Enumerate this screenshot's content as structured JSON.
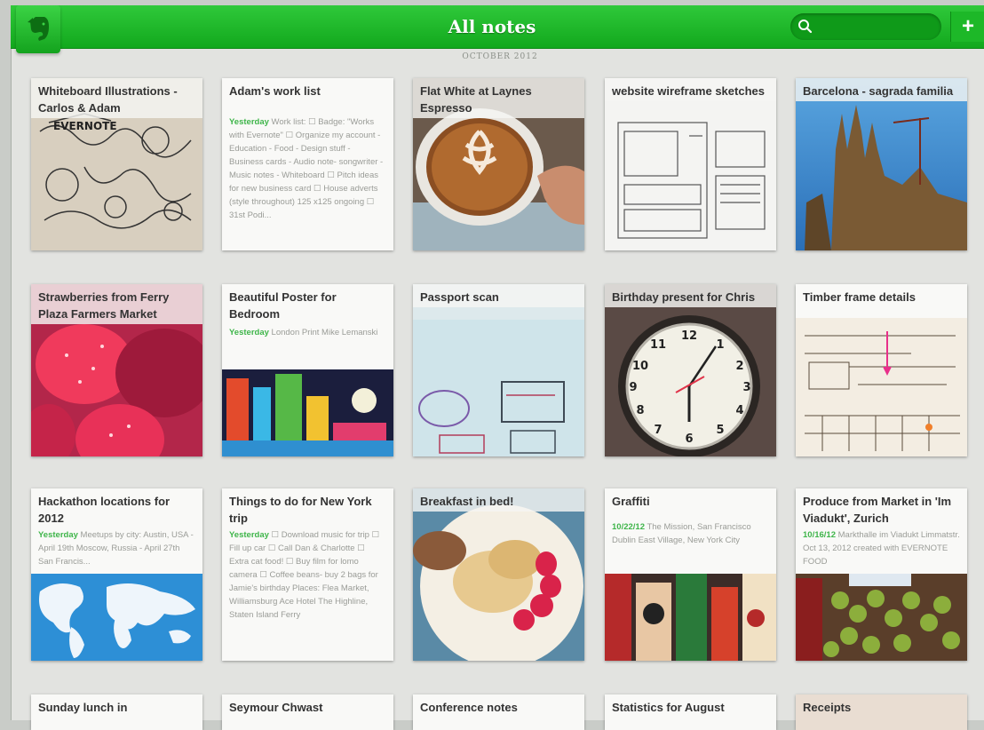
{
  "app": {
    "title": "All notes",
    "month": "OCTOBER 2012",
    "accent": "#22b82d"
  },
  "search": {
    "placeholder": "",
    "value": ""
  },
  "toolbar": {
    "new_note": "+"
  },
  "notes": [
    {
      "title": "Whiteboard Illustrations - Carlos & Adam",
      "date": "",
      "snippet": ""
    },
    {
      "title": "Adam's work list",
      "date": "Yesterday",
      "snippet": "Work list: ☐ Badge: \"Works with Evernote\" ☐ Organize my account - Education - Food - Design stuff - Business cards - Audio note- songwriter - Music notes - Whiteboard ☐ Pitch ideas for new business card ☐ House adverts (style throughout) 125 x125 ongoing ☐ 31st Podi..."
    },
    {
      "title": "Flat White at Laynes Espresso",
      "date": "",
      "snippet": ""
    },
    {
      "title": "website wireframe sketches",
      "date": "",
      "snippet": ""
    },
    {
      "title": "Barcelona - sagrada familia",
      "date": "",
      "snippet": ""
    },
    {
      "title": "Strawberries from Ferry Plaza Farmers Market",
      "date": "",
      "snippet": ""
    },
    {
      "title": "Beautiful  Poster for Bedroom",
      "date": "Yesterday",
      "snippet": "London Print Mike Lemanski"
    },
    {
      "title": "Passport scan",
      "date": "",
      "snippet": ""
    },
    {
      "title": "Birthday present for Chris",
      "date": "",
      "snippet": ""
    },
    {
      "title": "Timber frame details",
      "date": "",
      "snippet": ""
    },
    {
      "title": "Hackathon locations for 2012",
      "date": "Yesterday",
      "snippet": "Meetups by city: Austin, USA - April 19th Moscow, Russia - April 27th San Francis..."
    },
    {
      "title": "Things to do for New York trip",
      "date": "Yesterday",
      "snippet": "☐ Download music for trip ☐ Fill up car ☐ Call Dan & Charlotte ☐ Extra cat food! ☐ Buy film for lomo camera ☐ Coffee beans- buy 2 bags for Jamie's birthday Places: Flea Market, Williamsburg Ace Hotel The Highline, Staten Island Ferry"
    },
    {
      "title": "Breakfast in bed!",
      "date": "",
      "snippet": ""
    },
    {
      "title": "Graffiti",
      "date": "10/22/12",
      "snippet": "The Mission, San Francisco Dublin East Village, New York City"
    },
    {
      "title": "Produce from Market in 'Im Viadukt', Zurich",
      "date": "10/16/12",
      "snippet": "Markthalle im Viadukt Limmatstr. Oct 13, 2012 created with EVERNOTE FOOD"
    },
    {
      "title": "Sunday lunch in",
      "date": "",
      "snippet": ""
    },
    {
      "title": "Seymour Chwast",
      "date": "",
      "snippet": ""
    },
    {
      "title": "Conference notes",
      "date": "",
      "snippet": ""
    },
    {
      "title": "Statistics for August",
      "date": "",
      "snippet": ""
    },
    {
      "title": "Receipts",
      "date": "",
      "snippet": ""
    }
  ]
}
